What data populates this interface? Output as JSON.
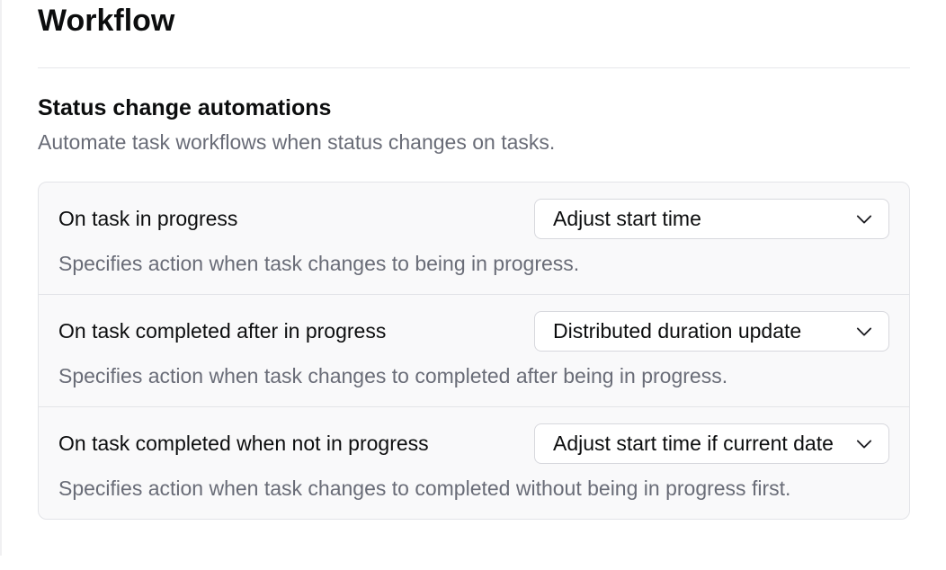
{
  "page": {
    "title": "Workflow"
  },
  "section": {
    "title": "Status change automations",
    "description": "Automate task workflows when status changes on tasks."
  },
  "rows": [
    {
      "label": "On task in progress",
      "selected": "Adjust start time",
      "help": "Specifies action when task changes to being in progress."
    },
    {
      "label": "On task completed after in progress",
      "selected": "Distributed duration update",
      "help": "Specifies action when task changes to completed after being in progress."
    },
    {
      "label": "On task completed when not in progress",
      "selected": "Adjust start time if current date",
      "help": "Specifies action when task changes to completed without being in progress first."
    }
  ]
}
